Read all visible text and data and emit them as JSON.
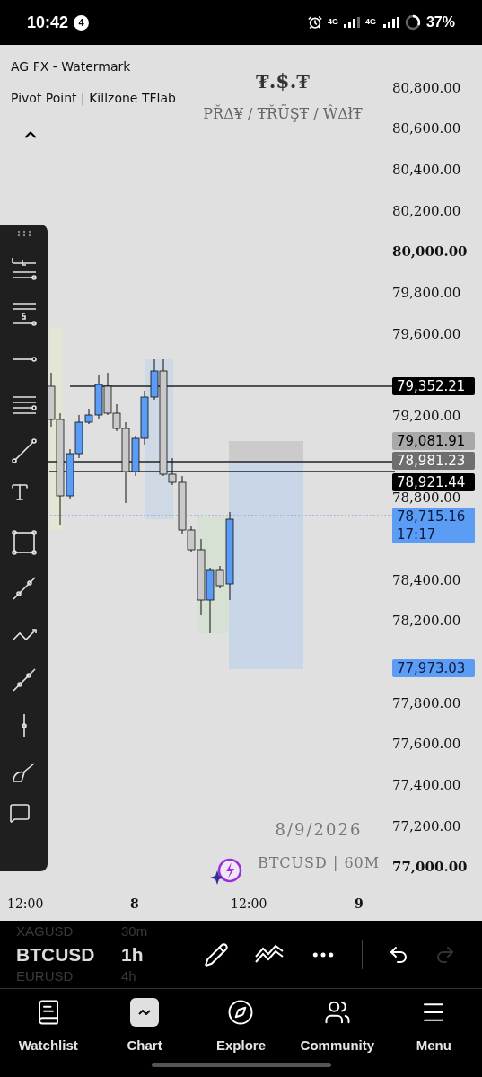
{
  "status_bar": {
    "time": "10:42",
    "notification_count": "4",
    "network_1": "4G",
    "network_2": "4G",
    "battery": "37%"
  },
  "chart": {
    "indicator_labels": [
      "AG FX - Watermark",
      "Pivot Point | Killzone TFlab"
    ],
    "watermark_title": "₮.$.₮",
    "watermark_subtitle": "PŘΔ¥ / ŦŘŨŞŦ / ŴΔłŦ",
    "watermark_date": "8/9/2026",
    "watermark_symbol": "BTCUSD | 60M",
    "price_axis": [
      {
        "kind": "label",
        "label": "80,800.00",
        "bold": false
      },
      {
        "kind": "label",
        "label": "80,600.00",
        "bold": false
      },
      {
        "kind": "label",
        "label": "80,400.00",
        "bold": false
      },
      {
        "kind": "label",
        "label": "80,200.00",
        "bold": false
      },
      {
        "kind": "label",
        "label": "80,000.00",
        "bold": true
      },
      {
        "kind": "label",
        "label": "79,800.00",
        "bold": false
      },
      {
        "kind": "label",
        "label": "79,600.00",
        "bold": false
      },
      {
        "kind": "gap"
      },
      {
        "kind": "label",
        "label": "79,200.00",
        "bold": false
      },
      {
        "kind": "gap"
      },
      {
        "kind": "label",
        "label": "78,800.00",
        "bold": false
      },
      {
        "kind": "gap"
      },
      {
        "kind": "label",
        "label": "78,400.00",
        "bold": false
      },
      {
        "kind": "label",
        "label": "78,200.00",
        "bold": false
      },
      {
        "kind": "gap"
      },
      {
        "kind": "label",
        "label": "77,800.00",
        "bold": false
      },
      {
        "kind": "label",
        "label": "77,600.00",
        "bold": false
      },
      {
        "kind": "label",
        "label": "77,400.00",
        "bold": false
      },
      {
        "kind": "label",
        "label": "77,200.00",
        "bold": false
      },
      {
        "kind": "label",
        "label": "77,000.00",
        "bold": true
      }
    ],
    "price_tags": [
      {
        "kind": "black",
        "label": "79,352.21"
      },
      {
        "kind": "gray",
        "label": "79,081.91"
      },
      {
        "kind": "darkgray",
        "label": "78,981.23"
      },
      {
        "kind": "black",
        "label": "78,921.44"
      },
      {
        "kind": "blue",
        "label": "78,715.16",
        "time": "17:17"
      },
      {
        "kind": "blue",
        "label": "77,973.03"
      }
    ],
    "time_axis": [
      {
        "label": "12:00",
        "bold": false
      },
      {
        "label": "8",
        "bold": true
      },
      {
        "label": "12:00",
        "bold": false
      },
      {
        "label": "9",
        "bold": true
      }
    ]
  },
  "symbol_picker": [
    {
      "symbol": "XAGUSD",
      "interval": "30m",
      "selected": false
    },
    {
      "symbol": "BTCUSD",
      "interval": "1h",
      "selected": true
    },
    {
      "symbol": "EURUSD",
      "interval": "4h",
      "selected": false
    }
  ],
  "actions": {
    "undo_disabled": false,
    "redo_disabled": true
  },
  "nav": [
    {
      "label": "Watchlist",
      "selected": false
    },
    {
      "label": "Chart",
      "selected": true
    },
    {
      "label": "Explore",
      "selected": false
    },
    {
      "label": "Community",
      "selected": false
    },
    {
      "label": "Menu",
      "selected": false
    }
  ]
}
